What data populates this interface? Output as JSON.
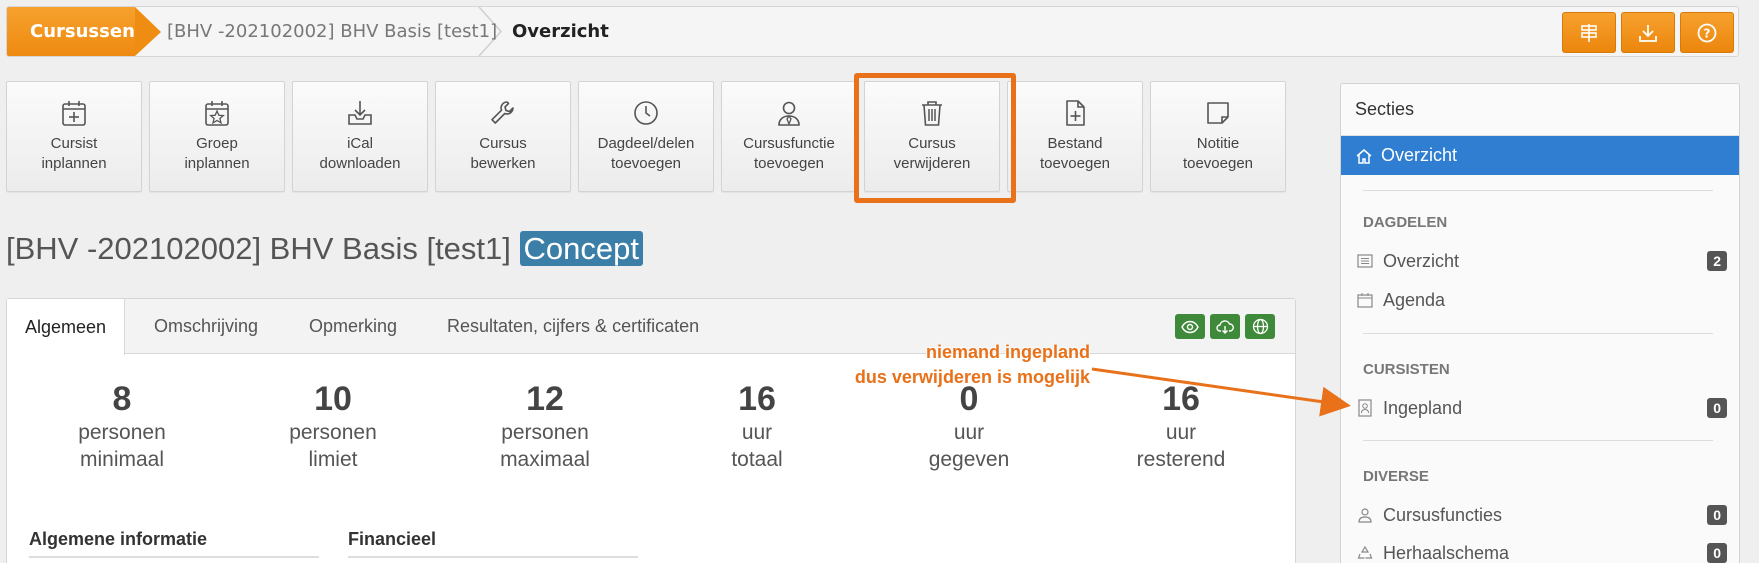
{
  "breadcrumb": {
    "items": [
      "Cursussen",
      "[BHV -202102002] BHV Basis [test1]",
      "Overzicht"
    ]
  },
  "top_buttons": [
    "signpost-icon",
    "download-icon",
    "help-icon"
  ],
  "actions": [
    {
      "icon": "calendar-plus-icon",
      "line1": "Cursist",
      "line2": "inplannen"
    },
    {
      "icon": "calendar-star-icon",
      "line1": "Groep",
      "line2": "inplannen"
    },
    {
      "icon": "download-tray-icon",
      "line1": "iCal",
      "line2": "downloaden"
    },
    {
      "icon": "wrench-icon",
      "line1": "Cursus",
      "line2": "bewerken"
    },
    {
      "icon": "clock-icon",
      "line1": "Dagdeel/delen",
      "line2": "toevoegen"
    },
    {
      "icon": "user-tie-icon",
      "line1": "Cursusfunctie",
      "line2": "toevoegen"
    },
    {
      "icon": "trash-icon",
      "line1": "Cursus",
      "line2": "verwijderen"
    },
    {
      "icon": "file-plus-icon",
      "line1": "Bestand",
      "line2": "toevoegen"
    },
    {
      "icon": "note-icon",
      "line1": "Notitie",
      "line2": "toevoegen"
    }
  ],
  "page": {
    "title": "[BHV -202102002] BHV Basis [test1]",
    "status": "Concept"
  },
  "tabs": [
    "Algemeen",
    "Omschrijving",
    "Opmerking",
    "Resultaten, cijfers & certificaten"
  ],
  "tab_buttons": [
    "eye-icon",
    "cloud-download-icon",
    "globe-icon"
  ],
  "stats": [
    {
      "value": "8",
      "l1": "personen",
      "l2": "minimaal"
    },
    {
      "value": "10",
      "l1": "personen",
      "l2": "limiet"
    },
    {
      "value": "12",
      "l1": "personen",
      "l2": "maximaal"
    },
    {
      "value": "16",
      "l1": "uur",
      "l2": "totaal"
    },
    {
      "value": "0",
      "l1": "uur",
      "l2": "gegeven"
    },
    {
      "value": "16",
      "l1": "uur",
      "l2": "resterend"
    }
  ],
  "subsections": [
    "Algemene informatie",
    "Financieel"
  ],
  "sidebar": {
    "title": "Secties",
    "active": "Overzicht",
    "groups": [
      {
        "heading": "DAGDELEN",
        "items": [
          {
            "label": "Overzicht",
            "badge": "2",
            "icon": "list-icon"
          },
          {
            "label": "Agenda",
            "badge": "",
            "icon": "calendar-icon"
          }
        ]
      },
      {
        "heading": "CURSISTEN",
        "items": [
          {
            "label": "Ingepland",
            "badge": "0",
            "icon": "id-badge-icon"
          }
        ]
      },
      {
        "heading": "DIVERSE",
        "items": [
          {
            "label": "Cursusfuncties",
            "badge": "0",
            "icon": "user-icon"
          },
          {
            "label": "Herhaalschema",
            "badge": "0",
            "icon": "recycle-icon"
          }
        ]
      }
    ]
  },
  "annotation": {
    "line1": "niemand ingepland",
    "line2": "dus verwijderen is mogelijk",
    "color": "#e8711a"
  },
  "colors": {
    "accent": "#f09318",
    "sidebar_active": "#2f7ed2",
    "status": "#3b7ea7",
    "green": "#3f8a3a"
  }
}
